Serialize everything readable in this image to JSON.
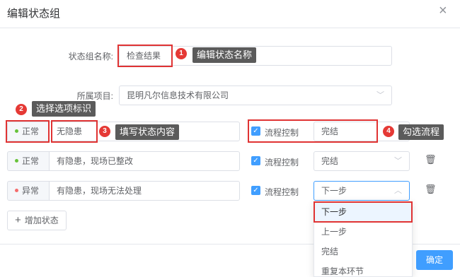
{
  "dialog": {
    "title": "编辑状态组",
    "close_glyph": "×",
    "confirm_label": "确定"
  },
  "form": {
    "group_name_label": "状态组名称:",
    "group_name_value": "检查结果",
    "project_label": "所属项目:",
    "project_value": "昆明凡尔信息技术有限公司"
  },
  "annotations": {
    "one": {
      "num": "1",
      "text": "编辑状态名称"
    },
    "two": {
      "num": "2",
      "text": "选择选项标识"
    },
    "three": {
      "num": "3",
      "text": "填写状态内容"
    },
    "four": {
      "num": "4",
      "text": "勾选流程"
    }
  },
  "rows": [
    {
      "status": "正常",
      "status_color": "#67c23a",
      "content": "无隐患",
      "flow_label": "流程控制",
      "flow_value": "完结"
    },
    {
      "status": "正常",
      "status_color": "#67c23a",
      "content": "有隐患，现场已整改",
      "flow_label": "流程控制",
      "flow_value": "完结"
    },
    {
      "status": "异常",
      "status_color": "#f56c6c",
      "content": "有隐患，现场无法处理",
      "flow_label": "流程控制",
      "flow_value": "下一步"
    }
  ],
  "add_button": {
    "icon": "+",
    "label": "增加状态"
  },
  "dropdown": {
    "options": [
      "下一步",
      "上一步",
      "完结",
      "重复本环节"
    ]
  },
  "colors": {
    "accent": "#409eff",
    "annotation_red": "#e53935"
  }
}
